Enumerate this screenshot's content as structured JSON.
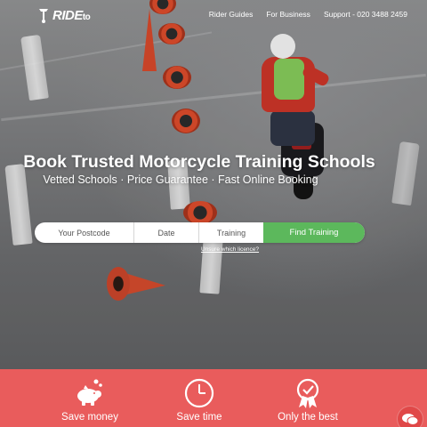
{
  "brand": {
    "name": "RIDE",
    "suffix": "to"
  },
  "nav": {
    "items": [
      {
        "label": "Rider Guides"
      },
      {
        "label": "For Business"
      },
      {
        "label": "Support - 020 3488 2459"
      }
    ]
  },
  "hero": {
    "headline": "Book Trusted Motorcycle Training Schools",
    "subline": "Vetted Schools · Price Guarantee · Fast Online Booking"
  },
  "search": {
    "postcode_label": "Your Postcode",
    "date_label": "Date",
    "training_label": "Training",
    "button_label": "Find Training",
    "licence_link": "Unsure which licence?"
  },
  "features": [
    {
      "label": "Save money",
      "icon": "piggy-bank-icon"
    },
    {
      "label": "Save time",
      "icon": "clock-icon"
    },
    {
      "label": "Only the best",
      "icon": "award-ribbon-icon"
    }
  ],
  "colors": {
    "accent_green": "#5cb85c",
    "feature_red": "#e95c5c"
  }
}
